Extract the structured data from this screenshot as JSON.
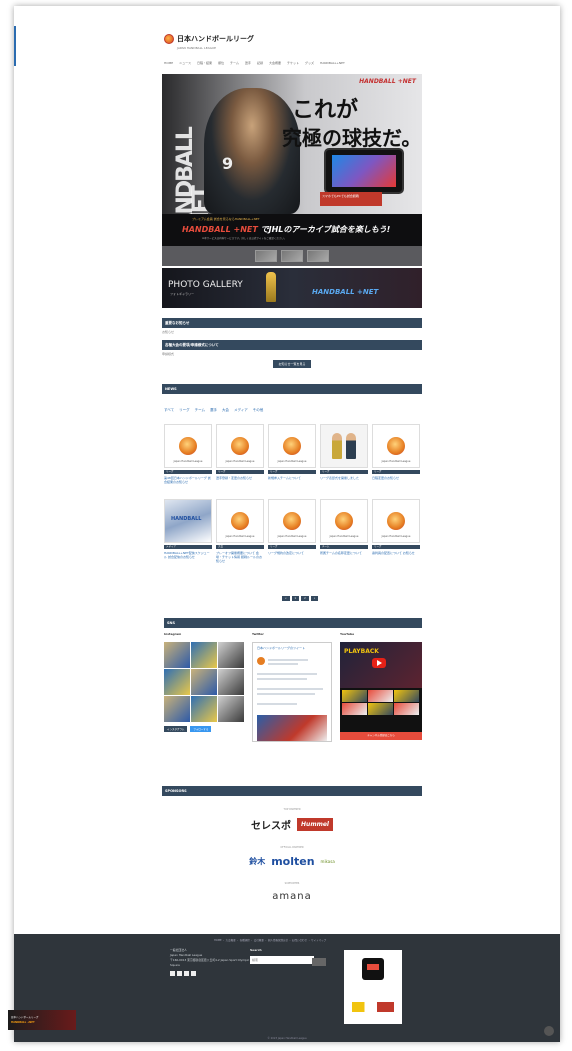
{
  "site": {
    "title": "日本ハンドボールリーグ",
    "subtitle": "JAPAN HANDBALL LEAGUE"
  },
  "nav": {
    "items": [
      "HOME",
      "ニュース",
      "日程・結果",
      "順位",
      "チーム",
      "選手",
      "記録",
      "大会概要",
      "チケット",
      "グッズ",
      "HANDBALL+NET"
    ]
  },
  "hero": {
    "brand": "HANDBALL +NET",
    "vertical_text": "HANDBALL +NET",
    "headline_1": "これが",
    "headline_2": "究極の球技だ。",
    "jersey_number": "9",
    "callout": "スマホでもPCでも試合観戦",
    "strip_a": "プレミアム会員 試合を見るならHANDBALL+NET",
    "strip_b_pre": "HANDBALL +NET",
    "strip_b_post": " でJHLのアーカイブ試合を楽しもう!",
    "strip_c": "※本サービスは有料サービスです。詳しくは公式サイトをご確認ください。"
  },
  "gallery": {
    "title": "PHOTO GALLERY",
    "sub": "フォトギャラリー",
    "brand": "HANDBALL +NET"
  },
  "sections": {
    "notice_title": "重要なお知らせ",
    "notice_text": "お知らせ",
    "notice2_title": "各種大会の要項/申請様式について",
    "notice2_text": "申請様式",
    "more_button": "お知らせ一覧を見る",
    "news_title": "NEWS",
    "sns_title": "SNS",
    "sponsors_title": "SPONSORS"
  },
  "tabs": [
    "すべて",
    "リーグ",
    "チーム",
    "選手",
    "大会",
    "メディア",
    "その他"
  ],
  "news": [
    {
      "cap": "Japan Handball League",
      "cat": "リーグ",
      "title": "第48回日本ハンドボールリーグ 試合結果のお知らせ",
      "kind": "emblem"
    },
    {
      "cap": "Japan Handball League",
      "cat": "リーグ",
      "title": "選手登録・変更のお知らせ",
      "kind": "emblem"
    },
    {
      "cap": "Japan Handball League",
      "cat": "リーグ",
      "title": "新規参入チームについて",
      "kind": "emblem"
    },
    {
      "cap": "",
      "cat": "リーグ",
      "title": "リーグ表彰式を開催しました",
      "kind": "people"
    },
    {
      "cap": "Japan Handball League",
      "cat": "リーグ",
      "title": "日程変更のお知らせ",
      "kind": "emblem"
    },
    {
      "cap": "",
      "cat": "メディア",
      "title": "HANDBALL+NET配信スケジュール 試合配信のお知らせ",
      "kind": "promo"
    },
    {
      "cap": "Japan Handball League",
      "cat": "大会",
      "title": "プレーオフ開催概要について 会場・チケット情報 観戦ルールのお知らせ",
      "kind": "emblem"
    },
    {
      "cap": "Japan Handball League",
      "cat": "リーグ",
      "title": "リーグ規約の改定について",
      "kind": "emblem"
    },
    {
      "cap": "Japan Handball League",
      "cat": "チーム",
      "title": "所属チームの名称変更について",
      "kind": "emblem"
    },
    {
      "cap": "Japan Handball League",
      "cat": "リーグ",
      "title": "審判員の配置について お知らせ",
      "kind": "emblem"
    }
  ],
  "pager": [
    "«",
    "1",
    "2",
    "»"
  ],
  "sns": {
    "instagram": "Instagram",
    "twitter": "Twitter",
    "youtube": "YouTube",
    "ig_btn_1": "インスタグラム",
    "ig_btn_2": "フォローする",
    "tweet_header": "日本ハンドボールリーグのツイート",
    "yt_badge": "PLAYBACK",
    "yt_button": "チャンネル登録はこちら"
  },
  "sponsors": {
    "cap_1": "TOP PARTNER",
    "logo_1a": "セレスポ",
    "logo_1b": "Hummel",
    "cap_2": "OFFICIAL PARTNER",
    "logo_2a": "鈴木",
    "logo_2b": "molten",
    "logo_2c": "mikasa",
    "cap_3": "SUPPORTER",
    "logo_3": "amana"
  },
  "footer": {
    "nav": "HOME ・ 大会概要 ・ 各種規程 ・ 会社概要 ・ 個人情報保護方針 ・ お問い合わせ ・ サイトマップ",
    "org": "一般社団法人",
    "org_en": "Japan Handball League",
    "address": "〒160-0013 東京都新宿区霞ヶ丘町4-2 Japan Sport Olympic Square",
    "search_label": "Search",
    "search_placeholder": "検索",
    "copyright": "© 2023 Japan Handball League",
    "corner_a": "日本ハンドボールリーグ",
    "corner_b": "HANDBALL +NET"
  },
  "colors": {
    "bar": "#34495e",
    "accent": "#c0392b",
    "link": "#2b6cb0",
    "footer": "#2f353b"
  }
}
